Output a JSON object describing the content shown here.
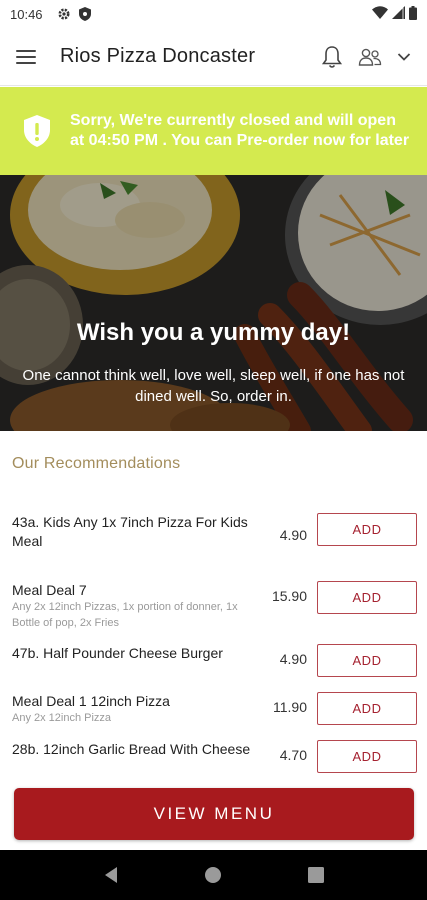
{
  "status_bar": {
    "time": "10:46"
  },
  "header": {
    "title": "Rios Pizza Doncaster"
  },
  "banner": {
    "text": "Sorry, We're currently closed and will open at 04:50 PM . You can Pre-order now for later"
  },
  "hero": {
    "title": "Wish you a yummy day!",
    "subtitle": "One cannot think well, love well, sleep well, if one has not dined well. So, order in."
  },
  "recommendations": {
    "title": "Our Recommendations",
    "items": [
      {
        "name": "43a. Kids Any 1x 7inch Pizza For Kids Meal",
        "desc": "",
        "price": "4.90",
        "button": "ADD"
      },
      {
        "name": "Meal Deal 7",
        "desc": "Any 2x 12inch Pizzas, 1x portion of donner, 1x Bottle of pop, 2x Fries",
        "price": "15.90",
        "button": "ADD"
      },
      {
        "name": "47b. Half Pounder Cheese Burger",
        "desc": "",
        "price": "4.90",
        "button": "ADD"
      },
      {
        "name": "Meal Deal 1 12inch Pizza",
        "desc": "Any 2x 12inch Pizza",
        "price": "11.90",
        "button": "ADD"
      },
      {
        "name": "28b. 12inch Garlic Bread With Cheese",
        "desc": "",
        "price": "4.70",
        "button": "ADD"
      }
    ]
  },
  "view_menu": {
    "label": "VIEW MENU"
  },
  "colors": {
    "banner": "#d4ea4f",
    "accent": "#a81a1e",
    "section_title": "#a38d5c"
  },
  "icons": [
    "settings-icon",
    "shield-icon",
    "wifi-icon",
    "signal-icon",
    "battery-icon",
    "menu-icon",
    "bell-icon",
    "user-group-icon",
    "chevron-down-icon",
    "alert-shield-icon",
    "back-icon",
    "home-icon",
    "recents-icon"
  ]
}
